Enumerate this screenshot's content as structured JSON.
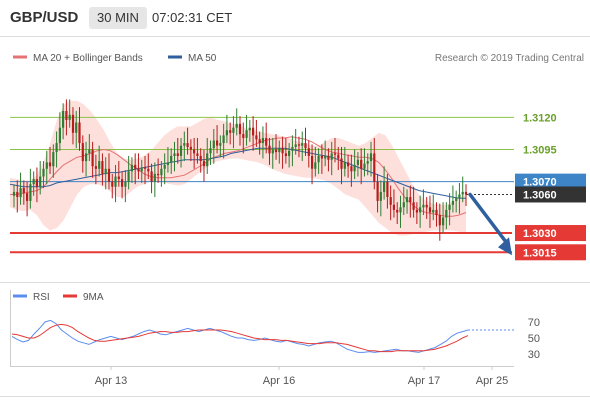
{
  "header": {
    "pair": "GBP/USD",
    "timeframe": "30 MIN",
    "time": "07:02:31 CET"
  },
  "legend": {
    "ma20_bb": "MA 20 + Bollinger Bands",
    "ma50": "MA 50",
    "source": "Research © 2019 Trading Central"
  },
  "rsi_legend": {
    "rsi": "RSI",
    "ma9": "9MA"
  },
  "colors": {
    "bull": "#2e7d32",
    "bear": "#b71c1c",
    "ma20": "#e57373",
    "band_fill": "#fde0dc",
    "ma50": "#2f5f9e",
    "resistance": "#8bc34a",
    "support": "#e53935",
    "pivot": "#3d85c6",
    "last": "#333333",
    "rsi": "#5b8def",
    "rsi_ma": "#e53935",
    "arrow": "#2f5f9e"
  },
  "chart_data": [
    {
      "type": "candlestick",
      "instrument": "GBP/USD",
      "interval": "30 MIN",
      "ylim": [
        1.2995,
        1.316
      ],
      "x_tick_labels": [
        "Apr 13",
        "Apr 16",
        "Apr 17",
        "Apr 25"
      ],
      "levels": [
        {
          "label": "1.3120",
          "value": 1.312,
          "kind": "resistance"
        },
        {
          "label": "1.3095",
          "value": 1.3095,
          "kind": "resistance"
        },
        {
          "label": "1.3070",
          "value": 1.307,
          "kind": "pivot"
        },
        {
          "label": "1.3060",
          "value": 1.306,
          "kind": "last"
        },
        {
          "label": "1.3030",
          "value": 1.303,
          "kind": "support"
        },
        {
          "label": "1.3015",
          "value": 1.3015,
          "kind": "support"
        }
      ],
      "close": [
        1.3062,
        1.3058,
        1.3065,
        1.3061,
        1.3055,
        1.3068,
        1.3072,
        1.3066,
        1.3074,
        1.308,
        1.3085,
        1.3082,
        1.3093,
        1.31,
        1.3112,
        1.3125,
        1.3118,
        1.3122,
        1.3108,
        1.3116,
        1.31,
        1.3086,
        1.3092,
        1.3095,
        1.3082,
        1.308,
        1.3086,
        1.3076,
        1.308,
        1.307,
        1.3066,
        1.3074,
        1.3072,
        1.3066,
        1.307,
        1.3078,
        1.3083,
        1.308,
        1.3078,
        1.3081,
        1.308,
        1.3078,
        1.307,
        1.3076,
        1.3075,
        1.308,
        1.3083,
        1.3085,
        1.309,
        1.3092,
        1.309,
        1.3098,
        1.31,
        1.3097,
        1.3095,
        1.3092,
        1.309,
        1.3086,
        1.3082,
        1.3092,
        1.3096,
        1.3102,
        1.3098,
        1.31,
        1.3106,
        1.311,
        1.3108,
        1.3112,
        1.3115,
        1.3107,
        1.3104,
        1.311,
        1.3112,
        1.3106,
        1.3103,
        1.31,
        1.3104,
        1.3098,
        1.3092,
        1.3095,
        1.3093,
        1.3096,
        1.3092,
        1.309,
        1.3094,
        1.3097,
        1.3099,
        1.3098,
        1.31,
        1.3096,
        1.309,
        1.308,
        1.3085,
        1.309,
        1.3088,
        1.309,
        1.3087,
        1.3092,
        1.3091,
        1.3088,
        1.308,
        1.3085,
        1.3082,
        1.3078,
        1.3083,
        1.3087,
        1.308,
        1.3084,
        1.3086,
        1.3092,
        1.307,
        1.3055,
        1.3062,
        1.307,
        1.3058,
        1.3052,
        1.3048,
        1.3046,
        1.305,
        1.3054,
        1.3058,
        1.3054,
        1.3048,
        1.3046,
        1.305,
        1.3052,
        1.305,
        1.3046,
        1.3048,
        1.3044,
        1.3036,
        1.3042,
        1.3048,
        1.3052,
        1.3055,
        1.3057,
        1.306,
        1.3062,
        1.306
      ],
      "ma20": [
        1.306,
        1.306,
        1.3061,
        1.3062,
        1.3063,
        1.3066,
        1.3072,
        1.3078,
        1.3083,
        1.3086,
        1.3089,
        1.309,
        1.3092,
        1.3094,
        1.3095,
        1.3094,
        1.3091,
        1.3087,
        1.3083,
        1.308,
        1.3076,
        1.3074,
        1.3073,
        1.3073,
        1.3073,
        1.3074,
        1.3075,
        1.3078,
        1.3081,
        1.3084,
        1.3088,
        1.309,
        1.3092,
        1.3093,
        1.3094,
        1.3096,
        1.3098,
        1.31,
        1.3102,
        1.3103,
        1.3104,
        1.3104,
        1.3105,
        1.3104,
        1.3103,
        1.3101,
        1.3098,
        1.3095,
        1.3093,
        1.3092,
        1.3091,
        1.309,
        1.3089,
        1.3089,
        1.3088,
        1.3085,
        1.3079,
        1.3072,
        1.3064,
        1.3057,
        1.3052,
        1.3048,
        1.3046,
        1.3045,
        1.3044,
        1.3043,
        1.3043,
        1.3044,
        1.3046
      ],
      "bb_upper": [
        1.3073,
        1.3072,
        1.3071,
        1.3071,
        1.3075,
        1.3085,
        1.31,
        1.3118,
        1.313,
        1.3133,
        1.3133,
        1.313,
        1.3125,
        1.3118,
        1.311,
        1.31,
        1.3092,
        1.3088,
        1.3087,
        1.3088,
        1.309,
        1.3094,
        1.31,
        1.3106,
        1.311,
        1.3113,
        1.3113,
        1.3113,
        1.3116,
        1.3119,
        1.312,
        1.3118,
        1.3117,
        1.3115,
        1.3114,
        1.3112,
        1.3111,
        1.3109,
        1.3108,
        1.3107,
        1.3106,
        1.3105,
        1.3103,
        1.3101,
        1.31,
        1.3098,
        1.3098,
        1.3101,
        1.3104,
        1.3104,
        1.3102,
        1.31,
        1.3098,
        1.31,
        1.3104,
        1.3108,
        1.3106,
        1.3098,
        1.3088,
        1.3078,
        1.3068,
        1.306,
        1.3055,
        1.3053,
        1.3052,
        1.3052,
        1.3054,
        1.3058,
        1.306
      ],
      "bb_lower": [
        1.305,
        1.3048,
        1.3047,
        1.3048,
        1.3044,
        1.3036,
        1.3032,
        1.3034,
        1.304,
        1.305,
        1.306,
        1.3066,
        1.3068,
        1.3068,
        1.3066,
        1.3062,
        1.3058,
        1.3058,
        1.3062,
        1.3066,
        1.3068,
        1.307,
        1.307,
        1.3069,
        1.3068,
        1.3067,
        1.3068,
        1.3072,
        1.3076,
        1.308,
        1.3084,
        1.3086,
        1.3087,
        1.3088,
        1.3088,
        1.3087,
        1.3086,
        1.3085,
        1.3083,
        1.308,
        1.3078,
        1.3076,
        1.3075,
        1.3074,
        1.3073,
        1.3073,
        1.3072,
        1.3071,
        1.3068,
        1.3064,
        1.306,
        1.3058,
        1.3056,
        1.305,
        1.3044,
        1.3038,
        1.3034,
        1.303,
        1.3028,
        1.3028,
        1.3029,
        1.303,
        1.3031,
        1.3032,
        1.3032,
        1.3032,
        1.3032,
        1.3031,
        1.303
      ],
      "ma50": [
        1.3068,
        1.3067,
        1.3066,
        1.3066,
        1.3066,
        1.3066,
        1.3067,
        1.3069,
        1.307,
        1.3071,
        1.3072,
        1.3073,
        1.3074,
        1.3075,
        1.3076,
        1.3077,
        1.3077,
        1.3078,
        1.3079,
        1.308,
        1.3081,
        1.3082,
        1.3083,
        1.3084,
        1.3085,
        1.3086,
        1.3087,
        1.3087,
        1.3087,
        1.3087,
        1.3088,
        1.3089,
        1.309,
        1.3092,
        1.3093,
        1.3094,
        1.3095,
        1.3096,
        1.3096,
        1.3096,
        1.3096,
        1.3096,
        1.3095,
        1.3094,
        1.3093,
        1.3092,
        1.3091,
        1.309,
        1.3089,
        1.3087,
        1.3085,
        1.3083,
        1.3081,
        1.3079,
        1.3077,
        1.3075,
        1.3073,
        1.3071,
        1.3069,
        1.3067,
        1.3065,
        1.3063,
        1.3062,
        1.3061,
        1.306,
        1.3059,
        1.3058,
        1.3057,
        1.3057
      ]
    },
    {
      "type": "line",
      "title": "RSI",
      "ylim": [
        20,
        85
      ],
      "y_ticks": [
        70,
        50,
        30
      ],
      "series": [
        {
          "name": "RSI",
          "values": [
            52,
            48,
            45,
            47,
            55,
            62,
            70,
            72,
            68,
            60,
            55,
            50,
            46,
            44,
            42,
            45,
            48,
            50,
            52,
            50,
            48,
            50,
            52,
            55,
            58,
            60,
            58,
            55,
            54,
            56,
            58,
            60,
            62,
            60,
            58,
            60,
            62,
            60,
            58,
            55,
            52,
            50,
            50,
            48,
            47,
            48,
            50,
            48,
            46,
            45,
            47,
            45,
            43,
            42,
            40,
            42,
            44,
            45,
            46,
            44,
            40,
            36,
            34,
            32,
            32,
            33,
            32,
            33,
            34,
            35,
            36,
            34,
            34,
            33,
            32,
            34,
            36,
            38,
            42,
            46,
            52,
            56,
            58,
            60
          ]
        },
        {
          "name": "9MA",
          "values": [
            55,
            54,
            52,
            50,
            50,
            53,
            58,
            63,
            66,
            67,
            66,
            63,
            58,
            54,
            50,
            47,
            46,
            46,
            47,
            48,
            49,
            50,
            51,
            52,
            54,
            56,
            57,
            58,
            58,
            57,
            57,
            58,
            58,
            59,
            60,
            60,
            60,
            60,
            60,
            59,
            58,
            56,
            54,
            52,
            50,
            49,
            48,
            48,
            48,
            47,
            47,
            46,
            45,
            44,
            43,
            43,
            43,
            44,
            44,
            44,
            43,
            42,
            40,
            38,
            36,
            34,
            34,
            33,
            33,
            33,
            34,
            34,
            34,
            34,
            34,
            34,
            35,
            36,
            38,
            40,
            43,
            46,
            50,
            53
          ]
        }
      ]
    }
  ]
}
